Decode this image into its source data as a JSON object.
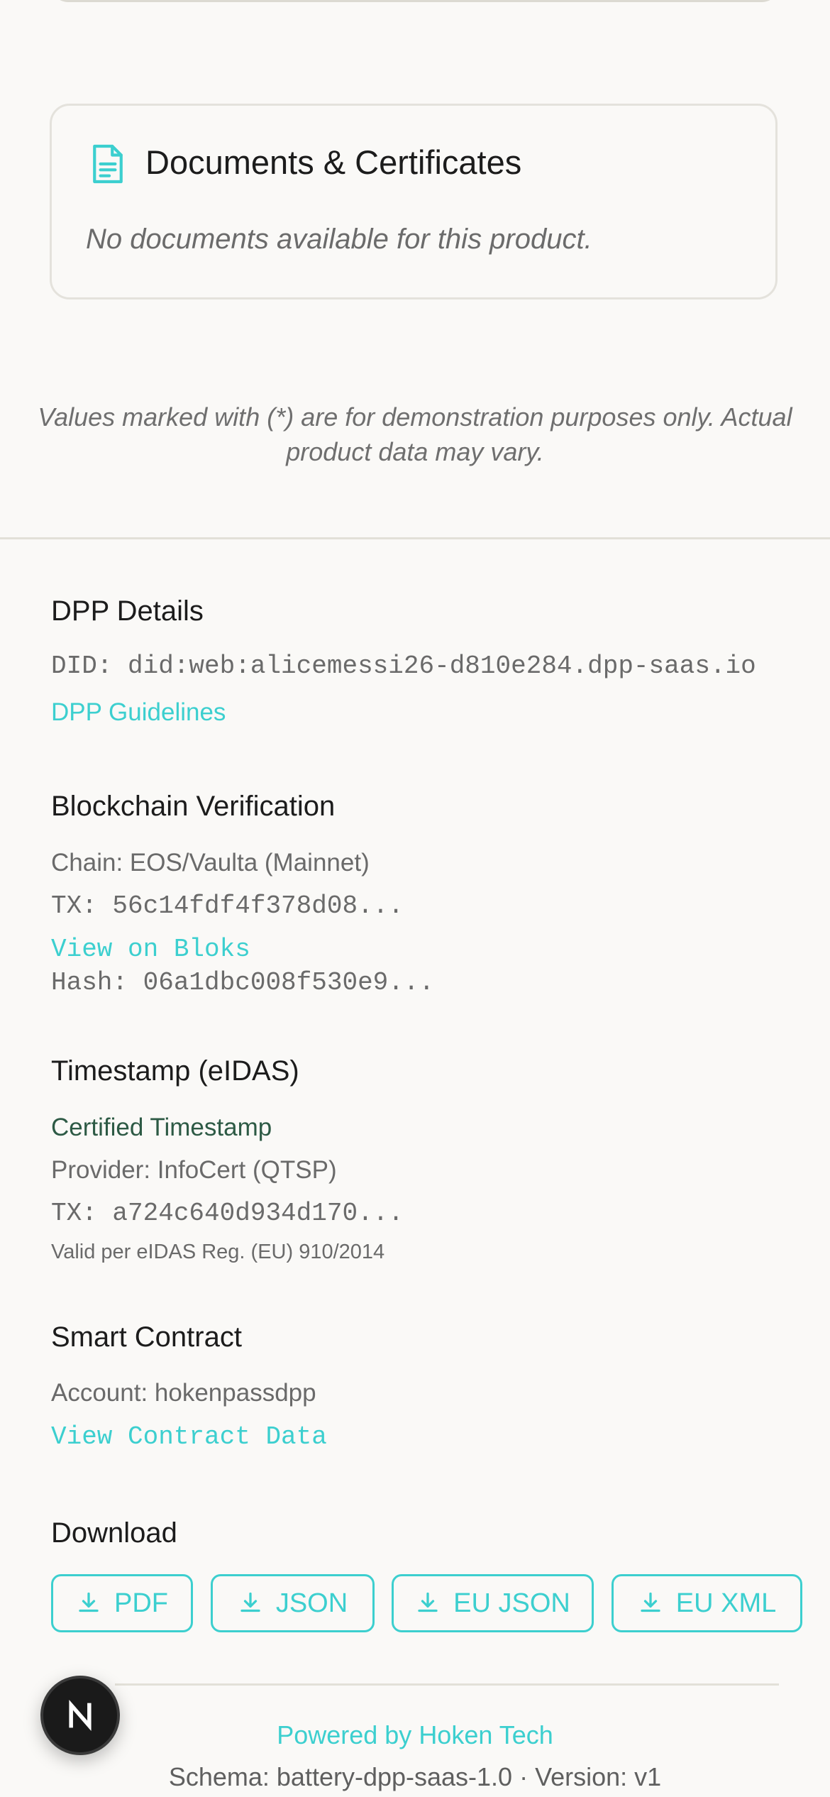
{
  "documents": {
    "title": "Documents & Certificates",
    "empty_text": "No documents available for this product."
  },
  "disclaimer": {
    "line1": "Values marked with (*) are for demonstration purposes only. Actual",
    "line2": "product data may vary."
  },
  "dpp_details": {
    "title": "DPP Details",
    "did": "DID: did:web:alicemessi26-d810e284.dpp-saas.io",
    "guidelines_link": "DPP Guidelines"
  },
  "blockchain": {
    "title": "Blockchain Verification",
    "chain": "Chain: EOS/Vaulta (Mainnet)",
    "tx": "TX: 56c14fdf4f378d08...",
    "view_link": "View on Bloks",
    "hash": "Hash: 06a1dbc008f530e9..."
  },
  "timestamp": {
    "title": "Timestamp (eIDAS)",
    "certified": "Certified Timestamp",
    "provider": "Provider: InfoCert (QTSP)",
    "tx": "TX: a724c640d934d170...",
    "valid_note": "Valid per eIDAS Reg. (EU) 910/2014"
  },
  "smart_contract": {
    "title": "Smart Contract",
    "account": "Account: hokenpassdpp",
    "view_link": "View Contract Data"
  },
  "download": {
    "title": "Download",
    "buttons": [
      "PDF",
      "JSON",
      "EU JSON",
      "EU XML"
    ]
  },
  "footer": {
    "powered_by": "Powered by Hoken Tech",
    "schema": "Schema: battery-dpp-saas-1.0 · Version: v1"
  },
  "badge": {
    "letter": "N",
    "icon": "n-logo-icon"
  },
  "colors": {
    "accent": "#3ccfcf",
    "certified": "#2d5a45",
    "background": "#faf9f7"
  }
}
